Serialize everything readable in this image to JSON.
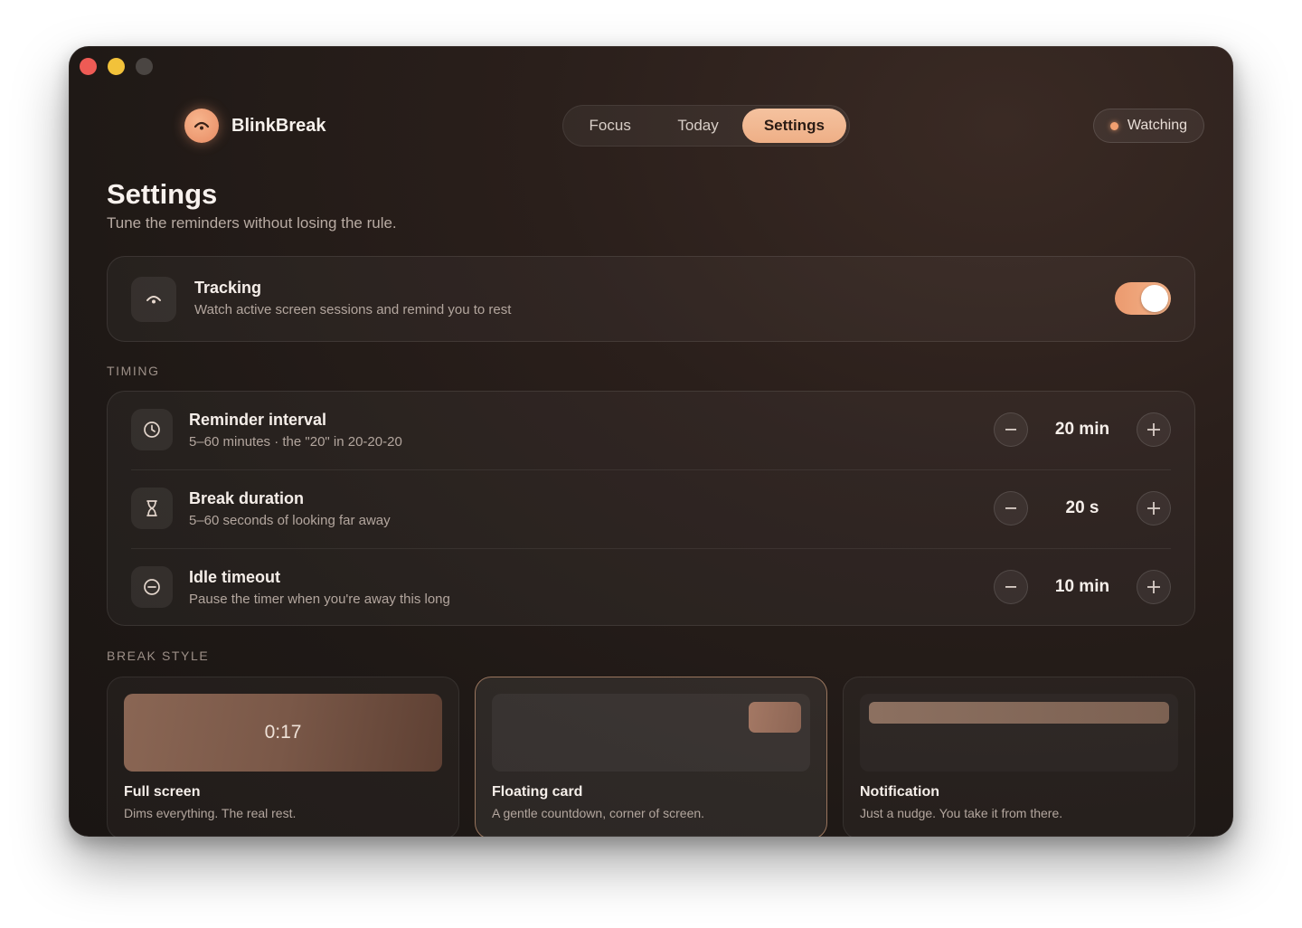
{
  "app": {
    "name": "BlinkBreak"
  },
  "tabs": [
    {
      "label": "Focus"
    },
    {
      "label": "Today"
    },
    {
      "label": "Settings"
    }
  ],
  "status": {
    "label": "Watching"
  },
  "page": {
    "title": "Settings",
    "subtitle": "Tune the reminders without losing the rule."
  },
  "tracking": {
    "title": "Tracking",
    "description": "Watch active screen sessions and remind you to rest",
    "enabled": true
  },
  "timing": {
    "label": "TIMING",
    "rows": [
      {
        "title": "Reminder interval",
        "description": "5–60 minutes · the \"20\" in 20-20-20",
        "value": "20 min"
      },
      {
        "title": "Break duration",
        "description": "5–60 seconds of looking far away",
        "value": "20 s"
      },
      {
        "title": "Idle timeout",
        "description": "Pause the timer when you're away this long",
        "value": "10 min"
      }
    ]
  },
  "break_style": {
    "label": "BREAK STYLE",
    "options": [
      {
        "title": "Full screen",
        "description": "Dims everything. The real rest.",
        "preview_text": "0:17"
      },
      {
        "title": "Floating card",
        "description": "A gentle countdown, corner of screen.",
        "selected": true
      },
      {
        "title": "Notification",
        "description": "Just a nudge. You take it from there."
      }
    ]
  },
  "colors": {
    "accent": "#eeaf86",
    "toggle_on": "#eb9a6f",
    "background": "#221a17"
  }
}
